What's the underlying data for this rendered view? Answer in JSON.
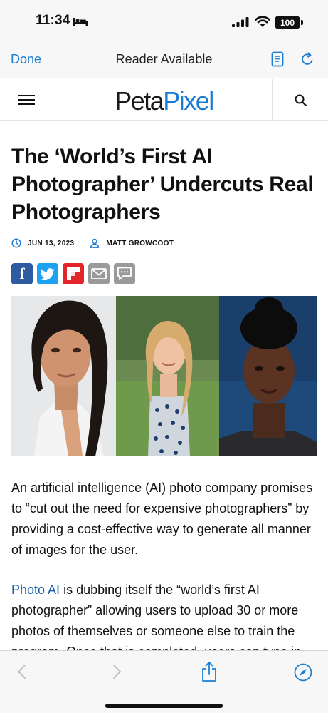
{
  "status_bar": {
    "time": "11:34",
    "battery": "100"
  },
  "browser": {
    "done_label": "Done",
    "title": "Reader Available"
  },
  "site": {
    "logo_part1": "Peta",
    "logo_part2": "Pixel",
    "logo_accent_color": "#1a7bd6"
  },
  "article": {
    "headline": "The ‘World’s First AI Photographer’ Undercuts Real Photographers",
    "date": "JUN 13, 2023",
    "author": "MATT GROWCOOT",
    "share_buttons": [
      "facebook-icon",
      "twitter-icon",
      "flipboard-icon",
      "email-icon",
      "comment-icon"
    ],
    "paragraph1": "An artificial intelligence (AI) photo company promises to “cut out the need for expensive photographers” by providing a cost-effective way to generate all manner of images for the user.",
    "paragraph2_link": "Photo AI",
    "paragraph2_rest": " is dubbing itself the “world’s first AI photographer” allowing users to upload 30 or more photos of themselves or someone else to train the program. Once that is completed, users can type in"
  },
  "toolbar": {
    "icons": [
      "back-icon",
      "forward-icon",
      "share-icon",
      "compass-icon"
    ]
  }
}
